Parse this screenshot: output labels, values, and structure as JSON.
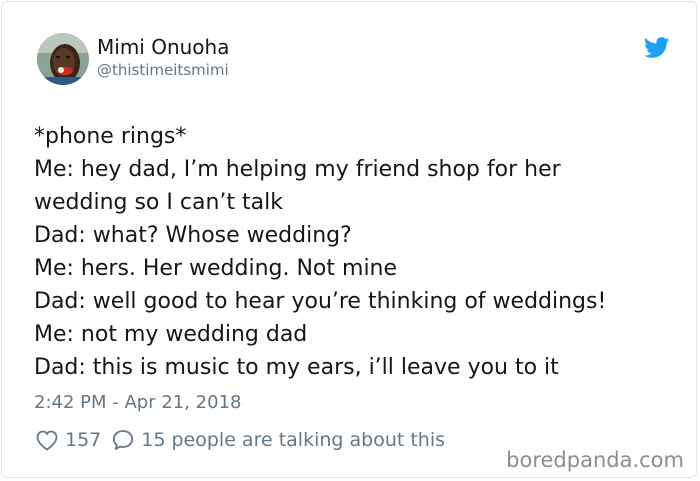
{
  "user": {
    "display_name": "Mimi Onuoha",
    "handle": "@thistimeitsmimi",
    "avatar_icon": "user-avatar-photo"
  },
  "brand_icon": "twitter-bird-icon",
  "tweet": {
    "lines": [
      "*phone rings*",
      "Me: hey dad, I’m helping my friend shop for her",
      "wedding so I can’t talk",
      "Dad: what? Whose wedding?",
      "Me: hers. Her wedding. Not mine",
      "Dad: well good to hear you’re thinking of weddings!",
      "Me: not my wedding dad",
      "Dad: this is music to my ears, i’ll leave you to it"
    ],
    "timestamp": "2:42 PM - Apr 21, 2018"
  },
  "stats": {
    "like_icon": "heart-icon",
    "likes": "157",
    "reply_icon": "speech-bubble-icon",
    "talking": "15 people are talking about this"
  },
  "watermark": "boredpanda.com",
  "colors": {
    "text_primary": "#14171a",
    "text_secondary": "#657786",
    "twitter_blue": "#1da1f2",
    "border": "#e1e8ed",
    "watermark": "#8d8d8d"
  }
}
